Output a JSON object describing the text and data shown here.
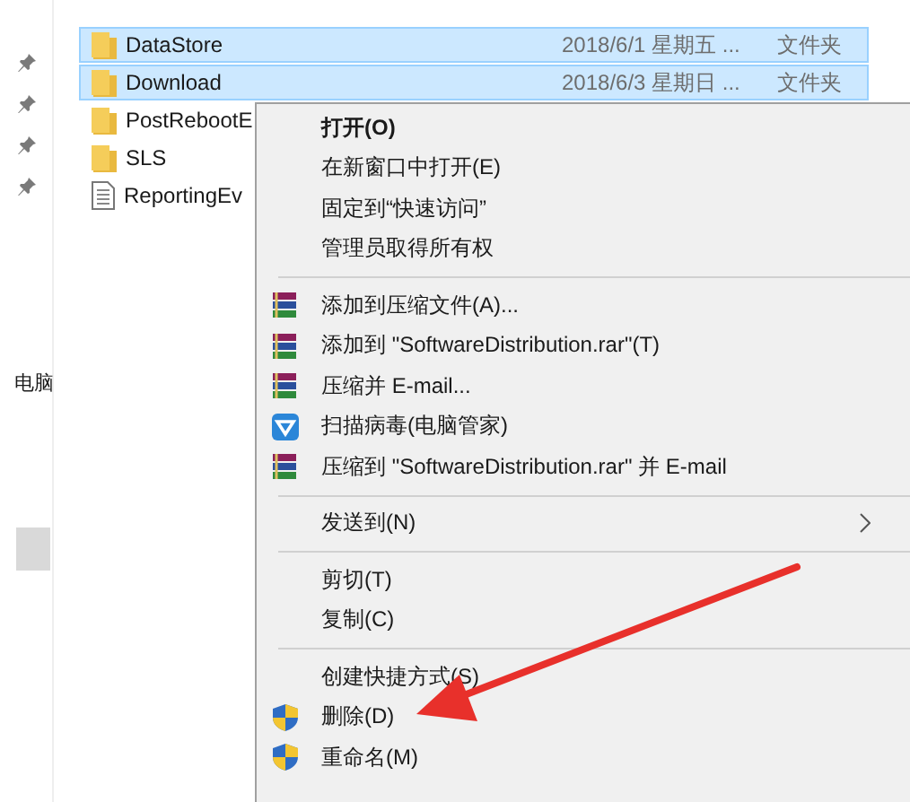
{
  "navigation": {
    "label": "电脑"
  },
  "files": [
    {
      "name": "DataStore",
      "date": "2018/6/1 星期五 ...",
      "type": "文件夹",
      "kind": "folder",
      "selected": true
    },
    {
      "name": "Download",
      "date": "2018/6/3 星期日 ...",
      "type": "文件夹",
      "kind": "folder",
      "selected": true
    },
    {
      "name": "PostRebootE",
      "kind": "folder",
      "selected": false
    },
    {
      "name": "SLS",
      "kind": "folder",
      "selected": false
    },
    {
      "name": "ReportingEv",
      "kind": "file",
      "selected": false
    }
  ],
  "context_menu": {
    "sections": [
      [
        {
          "label": "打开(O)",
          "default": true
        },
        {
          "label": "在新窗口中打开(E)",
          "default": false
        },
        {
          "label": "固定到“快速访问”",
          "default": false
        },
        {
          "label": "管理员取得所有权",
          "default": false
        }
      ],
      [
        {
          "label": "添加到压缩文件(A)...",
          "kind": "archive"
        },
        {
          "label": "添加到 \"SoftwareDistribution.rar\"(T)",
          "kind": "archive"
        },
        {
          "label": "压缩并 E-mail...",
          "kind": "archive"
        },
        {
          "label": "扫描病毒(电脑管家)",
          "kind": "antivirus"
        },
        {
          "label": "压缩到 \"SoftwareDistribution.rar\" 并 E-mail",
          "kind": "archive"
        }
      ],
      [
        {
          "label": "发送到(N)",
          "submenu": true
        }
      ],
      [
        {
          "label": "剪切(T)"
        },
        {
          "label": "复制(C)"
        }
      ],
      [
        {
          "label": "创建快捷方式(S)"
        },
        {
          "label": "删除(D)",
          "kind": "admin"
        },
        {
          "label": "重命名(M)",
          "kind": "admin"
        }
      ]
    ]
  }
}
